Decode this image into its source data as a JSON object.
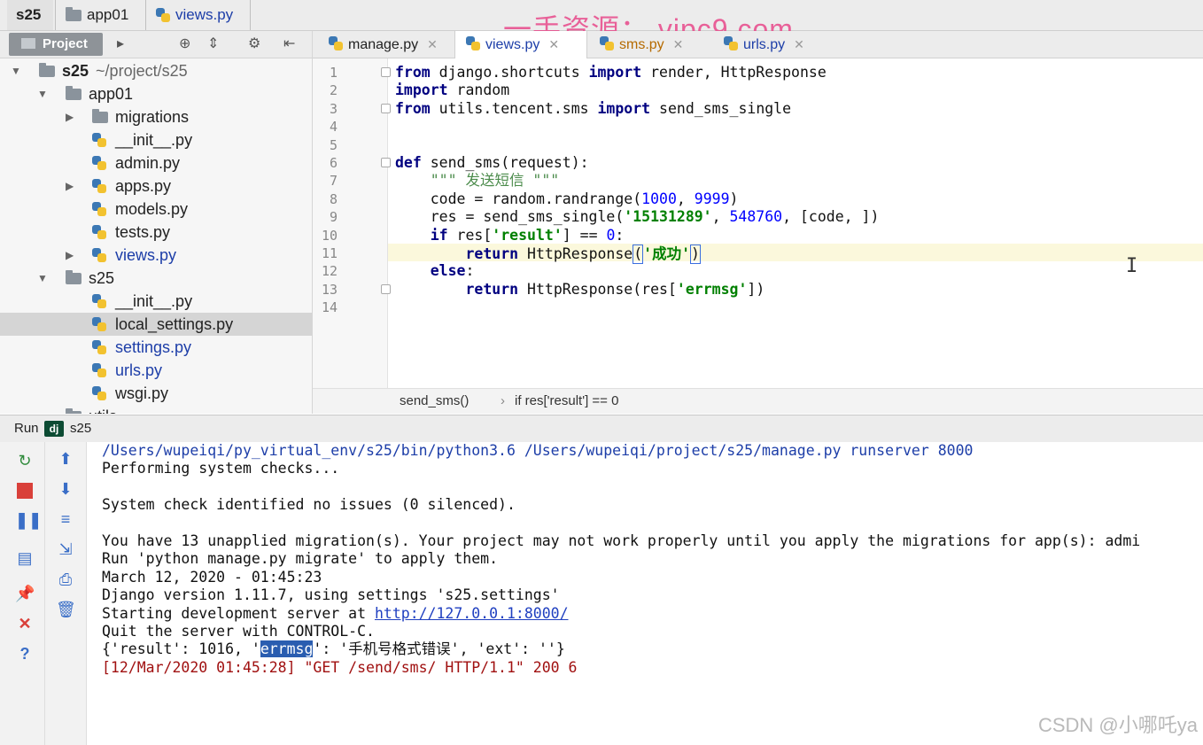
{
  "breadcrumb": {
    "items": [
      "s25",
      "app01",
      "views.py"
    ]
  },
  "watermark_top": "一手资源： vipc9.com",
  "watermark_bottom": "CSDN @小哪吒ya",
  "project_panel": {
    "tab_label": "Project",
    "tree": [
      {
        "label": "s25",
        "path": "~/project/s25",
        "kind": "folder",
        "level": 0,
        "expanded": true
      },
      {
        "label": "app01",
        "kind": "folder",
        "level": 1,
        "expanded": true
      },
      {
        "label": "migrations",
        "kind": "folder",
        "level": 2,
        "expanded": false
      },
      {
        "label": "__init__.py",
        "kind": "py",
        "level": 2
      },
      {
        "label": "admin.py",
        "kind": "py",
        "level": 2
      },
      {
        "label": "apps.py",
        "kind": "py",
        "level": 2,
        "expandable": true
      },
      {
        "label": "models.py",
        "kind": "py",
        "level": 2
      },
      {
        "label": "tests.py",
        "kind": "py",
        "level": 2
      },
      {
        "label": "views.py",
        "kind": "py",
        "level": 2,
        "expandable": true,
        "modified": true
      },
      {
        "label": "s25",
        "kind": "folder",
        "level": 1,
        "expanded": true
      },
      {
        "label": "__init__.py",
        "kind": "py",
        "level": 2
      },
      {
        "label": "local_settings.py",
        "kind": "py",
        "level": 2,
        "selected": true
      },
      {
        "label": "settings.py",
        "kind": "py",
        "level": 2,
        "modified": true
      },
      {
        "label": "urls.py",
        "kind": "py",
        "level": 2,
        "modified": true
      },
      {
        "label": "wsgi.py",
        "kind": "py",
        "level": 2
      },
      {
        "label": "utils",
        "kind": "folder",
        "level": 1,
        "expanded": true
      }
    ]
  },
  "editor_tabs": [
    {
      "label": "manage.py",
      "active": false
    },
    {
      "label": "views.py",
      "active": true
    },
    {
      "label": "sms.py",
      "active": false
    },
    {
      "label": "urls.py",
      "active": false
    }
  ],
  "editor": {
    "line_numbers": [
      "1",
      "2",
      "3",
      "4",
      "5",
      "6",
      "7",
      "8",
      "9",
      "10",
      "11",
      "12",
      "13",
      "14"
    ],
    "lines": {
      "l1": {
        "k1": "from",
        "t1": " django.shortcuts ",
        "k2": "import",
        "t2": " render, HttpResponse"
      },
      "l2": {
        "k1": "import",
        "t1": " random"
      },
      "l3": {
        "k1": "from",
        "t1": " utils.tencent.sms ",
        "k2": "import",
        "t2": " send_sms_single"
      },
      "l6": {
        "k1": "def",
        "t1": " send_sms(request):"
      },
      "l7": {
        "doc": "    \"\"\" 发送短信 \"\"\""
      },
      "l8": {
        "t1": "    code = random.randrange(",
        "n1": "1000",
        "t2": ", ",
        "n2": "9999",
        "t3": ")"
      },
      "l9": {
        "t1": "    res = send_sms_single(",
        "s1": "'15131289'",
        "t2": ", ",
        "n1": "548760",
        "t3": ", [code, ])"
      },
      "l10": {
        "t0": "    ",
        "k1": "if",
        "t1": " res[",
        "s1": "'result'",
        "t2": "] == ",
        "n1": "0",
        "t3": ":"
      },
      "l11": {
        "t0": "        ",
        "k1": "return",
        "t1": " HttpResponse",
        "p1": "(",
        "s1": "'成功'",
        "p2": ")"
      },
      "l12": {
        "t0": "    ",
        "k1": "else",
        "t1": ":"
      },
      "l13": {
        "t0": "        ",
        "k1": "return",
        "t1": " HttpResponse(res[",
        "s1": "'errmsg'",
        "t2": "])"
      }
    }
  },
  "editor_breadcrumb": {
    "function": "send_sms()",
    "condition": "if res['result'] == 0"
  },
  "run_panel": {
    "label": "Run",
    "config": "s25",
    "console_lines": [
      "/Users/wupeiqi/py_virtual_env/s25/bin/python3.6 /Users/wupeiqi/project/s25/manage.py runserver 8000",
      "Performing system checks...",
      "",
      "System check identified no issues (0 silenced).",
      "",
      "You have 13 unapplied migration(s). Your project may not work properly until you apply the migrations for app(s): admi",
      "Run 'python manage.py migrate' to apply them.",
      "March 12, 2020 - 01:45:23",
      "Django version 1.11.7, using settings 's25.settings'"
    ],
    "server_prefix": "Starting development server at ",
    "server_url": "http://127.0.0.1:8000/",
    "quit_line": "Quit the server with CONTROL-C.",
    "result_prefix": "{'result': 1016, '",
    "result_highlight": "errmsg",
    "result_suffix": "': '手机号格式错误', 'ext': ''}",
    "request_line": "[12/Mar/2020 01:45:28] \"GET /send/sms/ HTTP/1.1\" 200 6"
  },
  "colors": {
    "keyword": "#000080",
    "string": "#008000",
    "number": "#0000ff",
    "selection": "#2a5db0",
    "error_line": "#a01010"
  }
}
